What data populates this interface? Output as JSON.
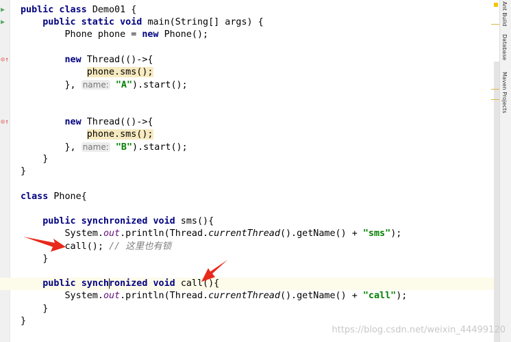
{
  "editor": {
    "current_line": 22,
    "lines": [
      [
        [
          "kw",
          "public class "
        ],
        [
          "p",
          "Demo01 {"
        ]
      ],
      [
        [
          "p",
          "    "
        ],
        [
          "kw",
          "public static void "
        ],
        [
          "p",
          "main(String[] args) {"
        ]
      ],
      [
        [
          "p",
          "        Phone phone = "
        ],
        [
          "kw",
          "new "
        ],
        [
          "p",
          "Phone();"
        ]
      ],
      [],
      [
        [
          "p",
          "        "
        ],
        [
          "kw",
          "new "
        ],
        [
          "p",
          "Thread(()->{"
        ]
      ],
      [
        [
          "p",
          "            "
        ],
        [
          "hl",
          "phone.sms();"
        ]
      ],
      [
        [
          "p",
          "        }, "
        ],
        [
          "hint",
          "name:"
        ],
        [
          "p",
          " "
        ],
        [
          "str",
          "\"A\""
        ],
        [
          "p",
          ").start();"
        ]
      ],
      [],
      [],
      [
        [
          "p",
          "        "
        ],
        [
          "kw",
          "new "
        ],
        [
          "p",
          "Thread(()->{"
        ]
      ],
      [
        [
          "p",
          "            "
        ],
        [
          "hl",
          "phone.sms();"
        ]
      ],
      [
        [
          "p",
          "        }, "
        ],
        [
          "hint",
          "name:"
        ],
        [
          "p",
          " "
        ],
        [
          "str",
          "\"B\""
        ],
        [
          "p",
          ").start();"
        ]
      ],
      [
        [
          "p",
          "    }"
        ]
      ],
      [
        [
          "p",
          "}"
        ]
      ],
      [],
      [
        [
          "kw",
          "class "
        ],
        [
          "p",
          "Phone{"
        ]
      ],
      [],
      [
        [
          "p",
          "    "
        ],
        [
          "kw",
          "public synchronized void "
        ],
        [
          "p",
          "sms(){"
        ]
      ],
      [
        [
          "p",
          "        System."
        ],
        [
          "field",
          "out"
        ],
        [
          "p",
          ".println(Thread."
        ],
        [
          "smeth",
          "currentThread"
        ],
        [
          "p",
          "().getName() + "
        ],
        [
          "str",
          "\"sms\""
        ],
        [
          "p",
          ");"
        ]
      ],
      [
        [
          "p",
          "        call(); "
        ],
        [
          "cmt",
          "// 这里也有锁"
        ]
      ],
      [
        [
          "p",
          "    }"
        ]
      ],
      [],
      [
        [
          "p",
          "    "
        ],
        [
          "kw",
          "public "
        ],
        [
          "kw",
          "synch"
        ],
        [
          "cursor",
          ""
        ],
        [
          "kw",
          "ronized void "
        ],
        [
          "p",
          "call(){"
        ]
      ],
      [
        [
          "p",
          "        System."
        ],
        [
          "field",
          "out"
        ],
        [
          "p",
          ".println(Thread."
        ],
        [
          "smeth",
          "currentThread"
        ],
        [
          "p",
          "().getName() + "
        ],
        [
          "str",
          "\"call\""
        ],
        [
          "p",
          ");"
        ]
      ],
      [
        [
          "p",
          "    }"
        ]
      ],
      [
        [
          "p",
          "}"
        ]
      ]
    ]
  },
  "tool_windows": [
    "Ant Build",
    "Database",
    "Maven Projects"
  ],
  "watermark": "https://blog.csdn.net/weixin_44499120",
  "colors": {
    "keyword": "#000080",
    "string": "#008000",
    "annotation_arrow": "#e8291c"
  }
}
